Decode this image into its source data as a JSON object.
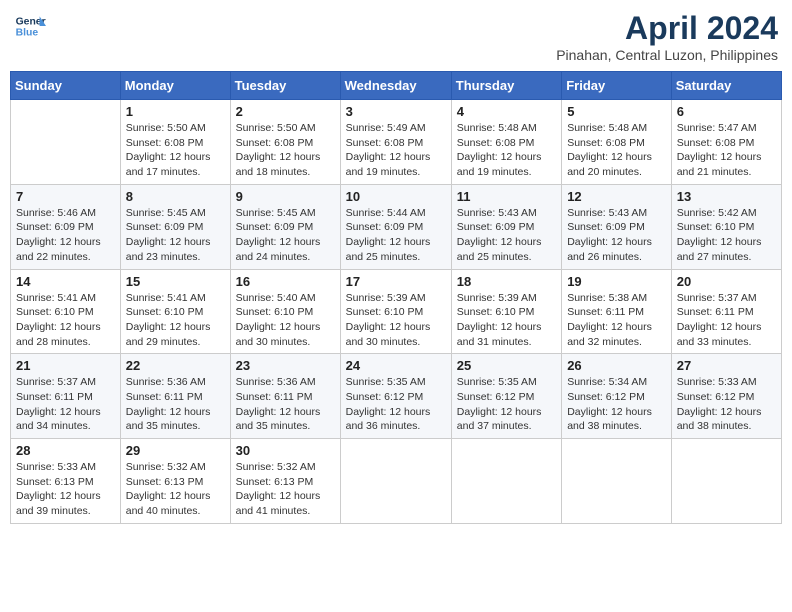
{
  "header": {
    "logo_line1": "General",
    "logo_line2": "Blue",
    "month_title": "April 2024",
    "subtitle": "Pinahan, Central Luzon, Philippines"
  },
  "weekdays": [
    "Sunday",
    "Monday",
    "Tuesday",
    "Wednesday",
    "Thursday",
    "Friday",
    "Saturday"
  ],
  "weeks": [
    [
      {
        "day": "",
        "info": ""
      },
      {
        "day": "1",
        "info": "Sunrise: 5:50 AM\nSunset: 6:08 PM\nDaylight: 12 hours\nand 17 minutes."
      },
      {
        "day": "2",
        "info": "Sunrise: 5:50 AM\nSunset: 6:08 PM\nDaylight: 12 hours\nand 18 minutes."
      },
      {
        "day": "3",
        "info": "Sunrise: 5:49 AM\nSunset: 6:08 PM\nDaylight: 12 hours\nand 19 minutes."
      },
      {
        "day": "4",
        "info": "Sunrise: 5:48 AM\nSunset: 6:08 PM\nDaylight: 12 hours\nand 19 minutes."
      },
      {
        "day": "5",
        "info": "Sunrise: 5:48 AM\nSunset: 6:08 PM\nDaylight: 12 hours\nand 20 minutes."
      },
      {
        "day": "6",
        "info": "Sunrise: 5:47 AM\nSunset: 6:08 PM\nDaylight: 12 hours\nand 21 minutes."
      }
    ],
    [
      {
        "day": "7",
        "info": "Sunrise: 5:46 AM\nSunset: 6:09 PM\nDaylight: 12 hours\nand 22 minutes."
      },
      {
        "day": "8",
        "info": "Sunrise: 5:45 AM\nSunset: 6:09 PM\nDaylight: 12 hours\nand 23 minutes."
      },
      {
        "day": "9",
        "info": "Sunrise: 5:45 AM\nSunset: 6:09 PM\nDaylight: 12 hours\nand 24 minutes."
      },
      {
        "day": "10",
        "info": "Sunrise: 5:44 AM\nSunset: 6:09 PM\nDaylight: 12 hours\nand 25 minutes."
      },
      {
        "day": "11",
        "info": "Sunrise: 5:43 AM\nSunset: 6:09 PM\nDaylight: 12 hours\nand 25 minutes."
      },
      {
        "day": "12",
        "info": "Sunrise: 5:43 AM\nSunset: 6:09 PM\nDaylight: 12 hours\nand 26 minutes."
      },
      {
        "day": "13",
        "info": "Sunrise: 5:42 AM\nSunset: 6:10 PM\nDaylight: 12 hours\nand 27 minutes."
      }
    ],
    [
      {
        "day": "14",
        "info": "Sunrise: 5:41 AM\nSunset: 6:10 PM\nDaylight: 12 hours\nand 28 minutes."
      },
      {
        "day": "15",
        "info": "Sunrise: 5:41 AM\nSunset: 6:10 PM\nDaylight: 12 hours\nand 29 minutes."
      },
      {
        "day": "16",
        "info": "Sunrise: 5:40 AM\nSunset: 6:10 PM\nDaylight: 12 hours\nand 30 minutes."
      },
      {
        "day": "17",
        "info": "Sunrise: 5:39 AM\nSunset: 6:10 PM\nDaylight: 12 hours\nand 30 minutes."
      },
      {
        "day": "18",
        "info": "Sunrise: 5:39 AM\nSunset: 6:10 PM\nDaylight: 12 hours\nand 31 minutes."
      },
      {
        "day": "19",
        "info": "Sunrise: 5:38 AM\nSunset: 6:11 PM\nDaylight: 12 hours\nand 32 minutes."
      },
      {
        "day": "20",
        "info": "Sunrise: 5:37 AM\nSunset: 6:11 PM\nDaylight: 12 hours\nand 33 minutes."
      }
    ],
    [
      {
        "day": "21",
        "info": "Sunrise: 5:37 AM\nSunset: 6:11 PM\nDaylight: 12 hours\nand 34 minutes."
      },
      {
        "day": "22",
        "info": "Sunrise: 5:36 AM\nSunset: 6:11 PM\nDaylight: 12 hours\nand 35 minutes."
      },
      {
        "day": "23",
        "info": "Sunrise: 5:36 AM\nSunset: 6:11 PM\nDaylight: 12 hours\nand 35 minutes."
      },
      {
        "day": "24",
        "info": "Sunrise: 5:35 AM\nSunset: 6:12 PM\nDaylight: 12 hours\nand 36 minutes."
      },
      {
        "day": "25",
        "info": "Sunrise: 5:35 AM\nSunset: 6:12 PM\nDaylight: 12 hours\nand 37 minutes."
      },
      {
        "day": "26",
        "info": "Sunrise: 5:34 AM\nSunset: 6:12 PM\nDaylight: 12 hours\nand 38 minutes."
      },
      {
        "day": "27",
        "info": "Sunrise: 5:33 AM\nSunset: 6:12 PM\nDaylight: 12 hours\nand 38 minutes."
      }
    ],
    [
      {
        "day": "28",
        "info": "Sunrise: 5:33 AM\nSunset: 6:13 PM\nDaylight: 12 hours\nand 39 minutes."
      },
      {
        "day": "29",
        "info": "Sunrise: 5:32 AM\nSunset: 6:13 PM\nDaylight: 12 hours\nand 40 minutes."
      },
      {
        "day": "30",
        "info": "Sunrise: 5:32 AM\nSunset: 6:13 PM\nDaylight: 12 hours\nand 41 minutes."
      },
      {
        "day": "",
        "info": ""
      },
      {
        "day": "",
        "info": ""
      },
      {
        "day": "",
        "info": ""
      },
      {
        "day": "",
        "info": ""
      }
    ]
  ]
}
